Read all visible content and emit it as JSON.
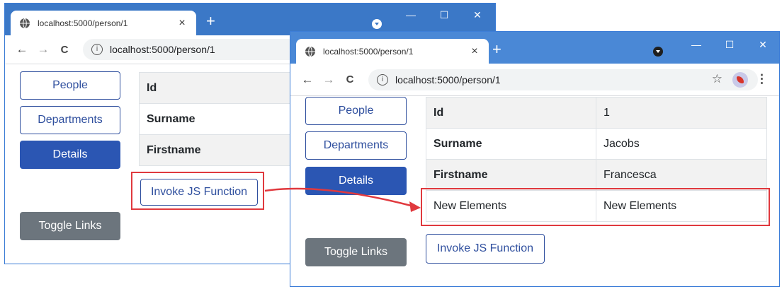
{
  "back_window": {
    "tab_title": "localhost:5000/person/1",
    "url": "localhost:5000/person/1",
    "nav": {
      "people": "People",
      "departments": "Departments",
      "details": "Details",
      "toggle": "Toggle Links"
    },
    "table": [
      {
        "label": "Id"
      },
      {
        "label": "Surname"
      },
      {
        "label": "Firstname"
      }
    ],
    "invoke_button": "Invoke JS Function"
  },
  "front_window": {
    "tab_title": "localhost:5000/person/1",
    "url": "localhost:5000/person/1",
    "nav": {
      "people": "People",
      "departments": "Departments",
      "details": "Details",
      "toggle": "Toggle Links"
    },
    "table": [
      {
        "label": "Id",
        "value": "1"
      },
      {
        "label": "Surname",
        "value": "Jacobs"
      },
      {
        "label": "Firstname",
        "value": "Francesca"
      },
      {
        "label": "New Elements",
        "value": "New Elements"
      }
    ],
    "invoke_button": "Invoke JS Function"
  },
  "glyphs": {
    "tab_close": "×",
    "new_tab": "+",
    "minimize": "—",
    "maximize": "☐",
    "close": "✕",
    "back": "←",
    "forward": "→",
    "reload": "C",
    "info": "i",
    "star": "☆",
    "menu": "⋮"
  },
  "colors": {
    "titlebar_back": "#3b78c7",
    "titlebar_front": "#4a88d6",
    "primary": "#2b56b3",
    "secondary": "#6c757d",
    "highlight": "#e0393e"
  }
}
